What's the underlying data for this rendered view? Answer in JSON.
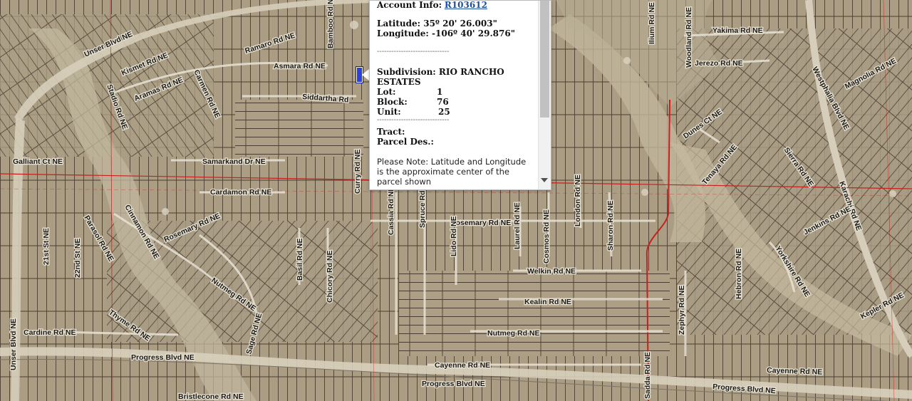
{
  "popup": {
    "account_label": "Account Info:",
    "account_id": "R103612",
    "latitude": "Latitude: 35º 20' 26.003\"",
    "longitude": "Longitude: -106º 40' 29.876\"",
    "divider": "------------------------------",
    "subdivision_label": "Subdivision:",
    "subdivision_value": "RIO RANCHO ESTATES",
    "lot_label": "Lot:",
    "lot_value": "1",
    "block_label": "Block:",
    "block_value": "76",
    "unit_label": "Unit:",
    "unit_value": "25",
    "tract_label": "Tract:",
    "parcel_label": "Parcel Des.:",
    "note": "Please Note: Latitude and Longitude is the approximate center of the parcel shown"
  },
  "streets": {
    "unser_top": "Unser Blvd NE",
    "unser_left": "Unser Blvd NE",
    "kismet": "Kismet Rd NE",
    "asmara": "Asmara Rd NE",
    "ramaro": "Ramaro Rd NE",
    "bamboo": "Bamboo Rd NE",
    "siddartha": "Siddartha Rd",
    "carmen": "Carmen Rd NE",
    "samarkand": "Samarkand Dr NE",
    "cardamon": "Cardamon Rd NE",
    "galliant": "Galliant Ct NE",
    "rosemary_left": "Rosemary Rd NE",
    "rosemary_center": "Rosemary Rd NE",
    "welkin": "Welkin Rd NE",
    "kealin": "Kealin Rd NE",
    "nutmeg": "Nutmeg Rd NE",
    "cayenne_center": "Cayenne Rd NE",
    "cayenne_right": "Cayenne Rd NE",
    "cardine": "Cardine Rd NE",
    "progress_left": "Progress Blvd NE",
    "progress_center": "Progress Blvd NE",
    "progress_right": "Progress Blvd NE",
    "yakima": "Yakima Rd NE",
    "jerezo": "Jerezo Rd NE",
    "jenkins": "Jenkins Rd NE",
    "westphalia": "Westphalia Blvd NE",
    "magnolia": "Magnolia Rd NE",
    "kepler": "Kepler Rd NE",
    "zephyr": "Zephyr Rd NE",
    "sierra": "Sierra Rd NE",
    "tenaya": "Tenaya Rd NE",
    "dunes": "Dunes Ct NE",
    "curry": "Curry Rd NE",
    "cassia": "Cassia Rd NE",
    "spruce": "Spruce Rd NE",
    "lido": "Lido Rd NE",
    "laurel": "Laurel Rd NE",
    "cosmos": "Cosmos Rd NE",
    "london": "London Rd NE",
    "sharon": "Sharon Rd NE",
    "basil": "Basil Rd NE",
    "chicory": "Chicory Rd NE",
    "sage": "Sage Rd NE",
    "nutmeg_left": "Nutmeg Rd NE",
    "rt21": "21st St NE",
    "rt22": "22nd St NE",
    "parasol": "Parasol Rd NE",
    "cinnamon": "Cinnamon Rd NE",
    "thyme": "Thyme Rd NE",
    "aramas": "Aramas Rd NE",
    "stadio": "Stadio Rd NE",
    "yorkshire": "Yorkshire Rd NE",
    "karachi": "Karachi Rd NE",
    "sadda": "Sadda Rd NE",
    "hebron": "Hebron Rd NE",
    "ilium": "Ilium Rd NE",
    "woodland": "Woodland Rd NE",
    "bristlecone": "Bristlecone Rd NE"
  }
}
